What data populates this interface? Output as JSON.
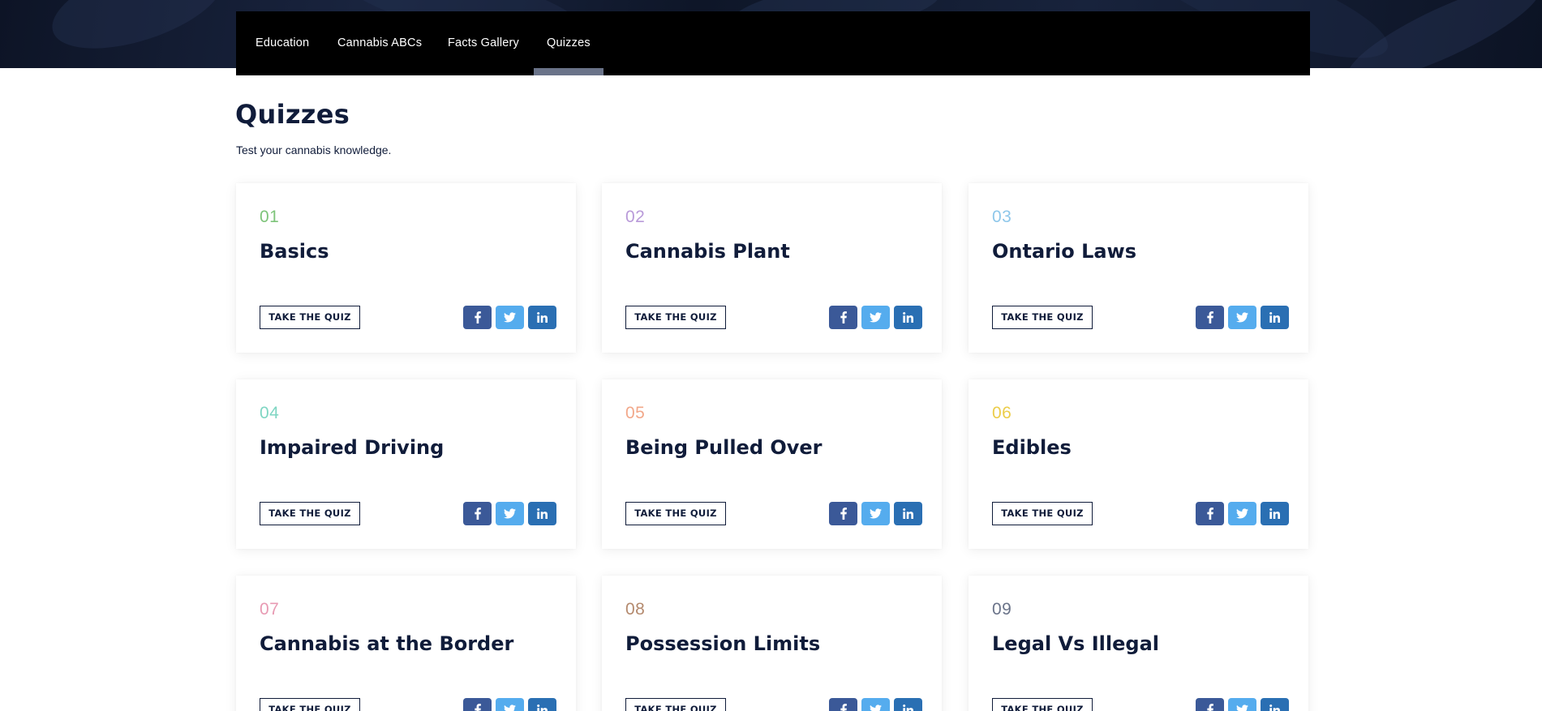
{
  "nav": {
    "items": [
      {
        "label": "Education"
      },
      {
        "label": "Cannabis ABCs"
      },
      {
        "label": "Facts Gallery"
      },
      {
        "label": "Quizzes"
      }
    ]
  },
  "page": {
    "title": "Quizzes",
    "subtitle": "Test your cannabis knowledge."
  },
  "cards": [
    {
      "number": "01",
      "title": "Basics",
      "number_color": "#7ec47a",
      "cta": "TAKE THE QUIZ"
    },
    {
      "number": "02",
      "title": "Cannabis Plant",
      "number_color": "#b99ad9",
      "cta": "TAKE THE QUIZ"
    },
    {
      "number": "03",
      "title": "Ontario Laws",
      "number_color": "#8ec7ea",
      "cta": "TAKE THE QUIZ"
    },
    {
      "number": "04",
      "title": "Impaired Driving",
      "number_color": "#7fd6c3",
      "cta": "TAKE THE QUIZ"
    },
    {
      "number": "05",
      "title": "Being Pulled Over",
      "number_color": "#f2a88a",
      "cta": "TAKE THE QUIZ"
    },
    {
      "number": "06",
      "title": "Edibles",
      "number_color": "#eccd4a",
      "cta": "TAKE THE QUIZ"
    },
    {
      "number": "07",
      "title": "Cannabis at the Border",
      "number_color": "#e89ab3",
      "cta": "TAKE THE QUIZ"
    },
    {
      "number": "08",
      "title": "Possession Limits",
      "number_color": "#b48a6e",
      "cta": "TAKE THE QUIZ"
    },
    {
      "number": "09",
      "title": "Legal Vs Illegal",
      "number_color": "#6a7389",
      "cta": "TAKE THE QUIZ"
    }
  ],
  "share_icons": {
    "facebook": {
      "icon": "facebook-icon",
      "color": "#3b5998"
    },
    "twitter": {
      "icon": "twitter-icon",
      "color": "#55acee"
    },
    "linkedin": {
      "icon": "linkedin-icon",
      "color": "#2a6fb3"
    }
  },
  "colors": {
    "title_text": "#101c3a",
    "nav_bg": "#000000",
    "nav_active_indicator": "#6a7389"
  }
}
